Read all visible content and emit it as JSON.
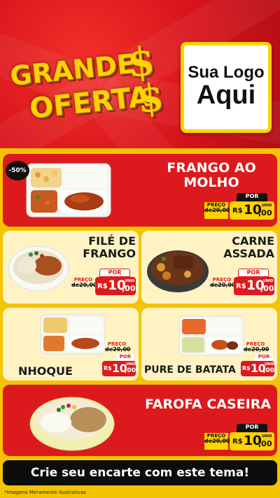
{
  "header": {
    "title_line1": "GRANDE",
    "title_line2": "OFERTA",
    "currency_symbol": "$",
    "logo_line1": "Sua Logo",
    "logo_line2": "Aqui"
  },
  "discount_badge": "-50%",
  "products": [
    {
      "name_line1": "FRANGO AO",
      "name_line2": "MOLHO",
      "preco_label": "PREÇO",
      "de": "de",
      "old_price": "20,00",
      "por_label": "POR",
      "currency": "R$",
      "price_int": "10",
      "price_cents": ",00",
      "unit": "UNID"
    },
    {
      "name_line1": "FILÉ DE",
      "name_line2": "FRANGO",
      "preco_label": "PREÇO",
      "de": "de",
      "old_price": "20,00",
      "por_label": "POR",
      "currency": "R$",
      "price_int": "10",
      "price_cents": ",00",
      "unit": "UNID"
    },
    {
      "name_line1": "CARNE",
      "name_line2": "ASSADA",
      "preco_label": "PREÇO",
      "de": "de",
      "old_price": "20,00",
      "por_label": "POR",
      "currency": "R$",
      "price_int": "10",
      "price_cents": ",00",
      "unit": "UNID"
    },
    {
      "name_line1": "NHOQUE",
      "preco_label": "PREÇO",
      "de": "de",
      "old_price": "20,00",
      "por_label": "POR",
      "currency": "R$",
      "price_int": "10",
      "price_cents": ",00",
      "unit": "UNID"
    },
    {
      "name_line1": "PURE DE BATATA",
      "preco_label": "PREÇO",
      "de": "de",
      "old_price": "20,00",
      "por_label": "POR",
      "currency": "R$",
      "price_int": "10",
      "price_cents": ",00",
      "unit": "UNID"
    },
    {
      "name_line1": "FAROFA CASEIRA",
      "preco_label": "PREÇO",
      "de": "de",
      "old_price": "20,00",
      "por_label": "POR",
      "currency": "R$",
      "price_int": "10",
      "price_cents": ",00",
      "unit": "UNID"
    }
  ],
  "banner_text": "Crie seu encarte com este tema!",
  "disclaimer": "*Imagens Meramente Ilustrativas",
  "colors": {
    "red": "#dc1a1e",
    "yellow": "#ffd200",
    "cream": "#fff3c4",
    "black": "#111111"
  }
}
